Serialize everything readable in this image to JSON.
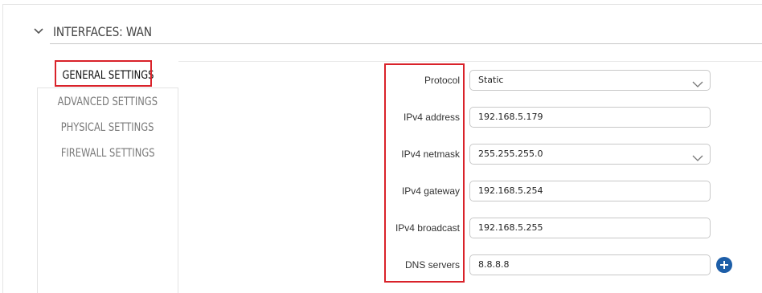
{
  "section": {
    "title": "INTERFACES: WAN"
  },
  "tabs": [
    {
      "label": "GENERAL SETTINGS",
      "active": true
    },
    {
      "label": "ADVANCED SETTINGS",
      "active": false
    },
    {
      "label": "PHYSICAL SETTINGS",
      "active": false
    },
    {
      "label": "FIREWALL SETTINGS",
      "active": false
    }
  ],
  "fields": {
    "protocol": {
      "label": "Protocol",
      "value": "Static",
      "type": "select"
    },
    "ipv4_address": {
      "label": "IPv4 address",
      "value": "192.168.5.179",
      "type": "input"
    },
    "ipv4_netmask": {
      "label": "IPv4 netmask",
      "value": "255.255.255.0",
      "type": "select"
    },
    "ipv4_gateway": {
      "label": "IPv4 gateway",
      "value": "192.168.5.254",
      "type": "input"
    },
    "ipv4_broadcast": {
      "label": "IPv4 broadcast",
      "value": "192.168.5.255",
      "type": "input"
    },
    "dns_servers": {
      "label": "DNS servers",
      "value": "8.8.8.8",
      "type": "input"
    }
  },
  "icons": {
    "collapse": "chevron-down-icon",
    "select_arrow": "chevron-down-icon",
    "add": "plus-icon"
  },
  "colors": {
    "highlight_box": "#d9222a",
    "add_button": "#1d5ea8"
  }
}
